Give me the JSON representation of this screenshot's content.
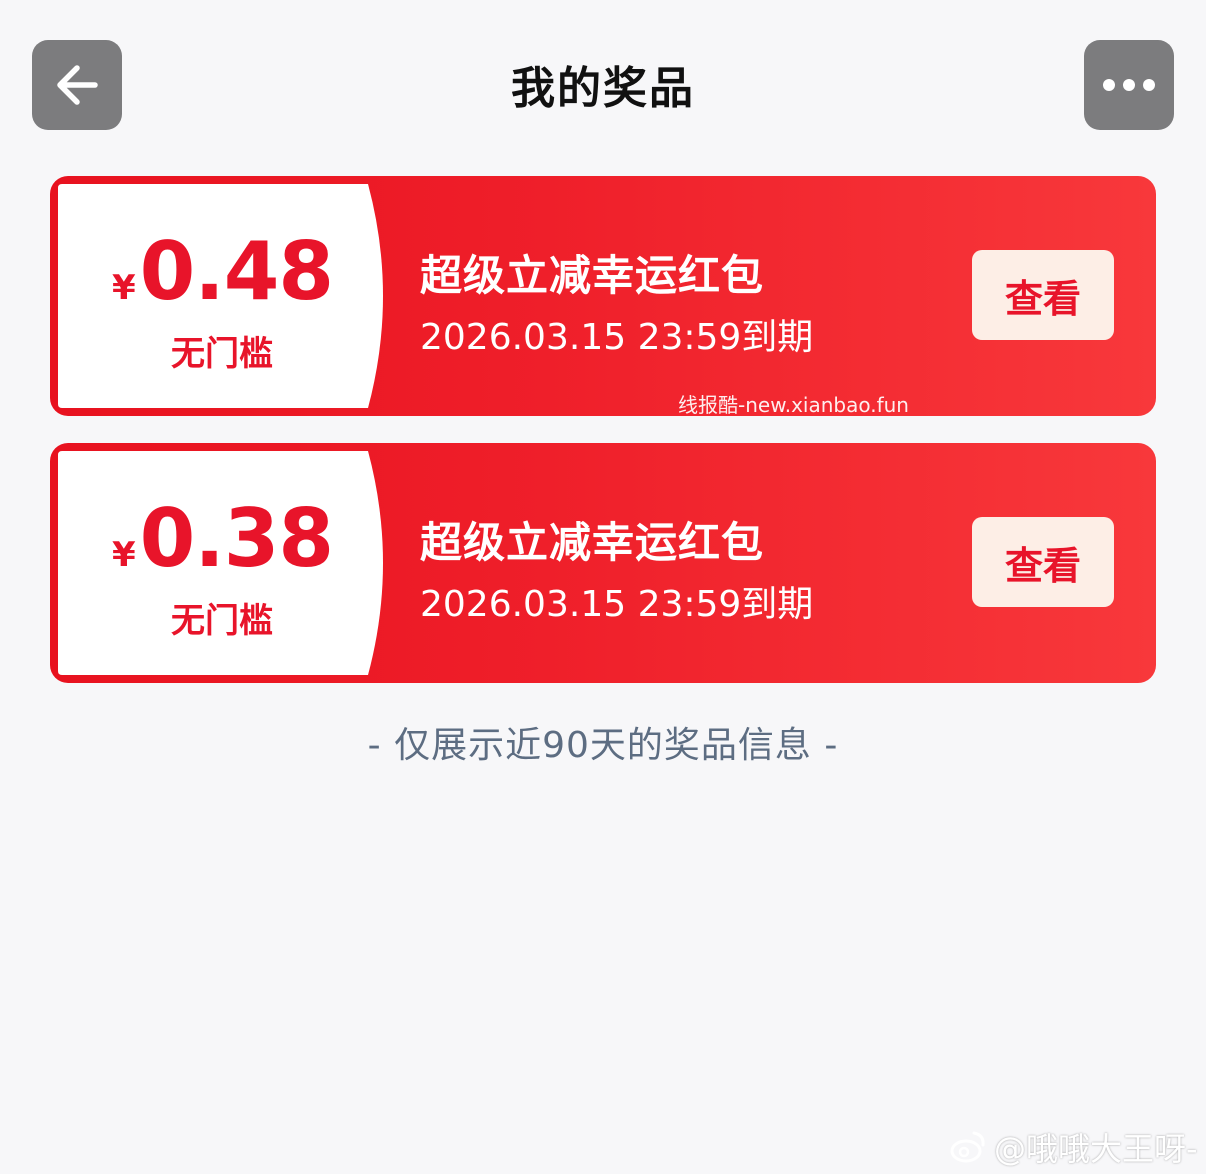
{
  "header": {
    "title": "我的奖品",
    "back_icon": "arrow-left-icon",
    "more_icon": "more-horizontal-icon"
  },
  "prizes": [
    {
      "currency": "¥",
      "amount": "0.48",
      "threshold": "无门槛",
      "name": "超级立减幸运红包",
      "expiry": "2026.03.15 23:59到期",
      "action_label": "查看"
    },
    {
      "currency": "¥",
      "amount": "0.38",
      "threshold": "无门槛",
      "name": "超级立减幸运红包",
      "expiry": "2026.03.15 23:59到期",
      "action_label": "查看"
    }
  ],
  "watermarks": {
    "site": "线报酷-new.xianbao.fun",
    "author": "@哦哦大王呀-"
  },
  "footer": {
    "note": "- 仅展示近90天的奖品信息 -"
  },
  "colors": {
    "accent_red": "#e8142a",
    "card_gradient_start": "#e8121f",
    "card_gradient_end": "#f8383b",
    "button_bg": "#fdeee6",
    "page_bg": "#f7f7f9",
    "icon_button_bg": "#7c7c7e",
    "footer_text": "#5d6d82"
  }
}
